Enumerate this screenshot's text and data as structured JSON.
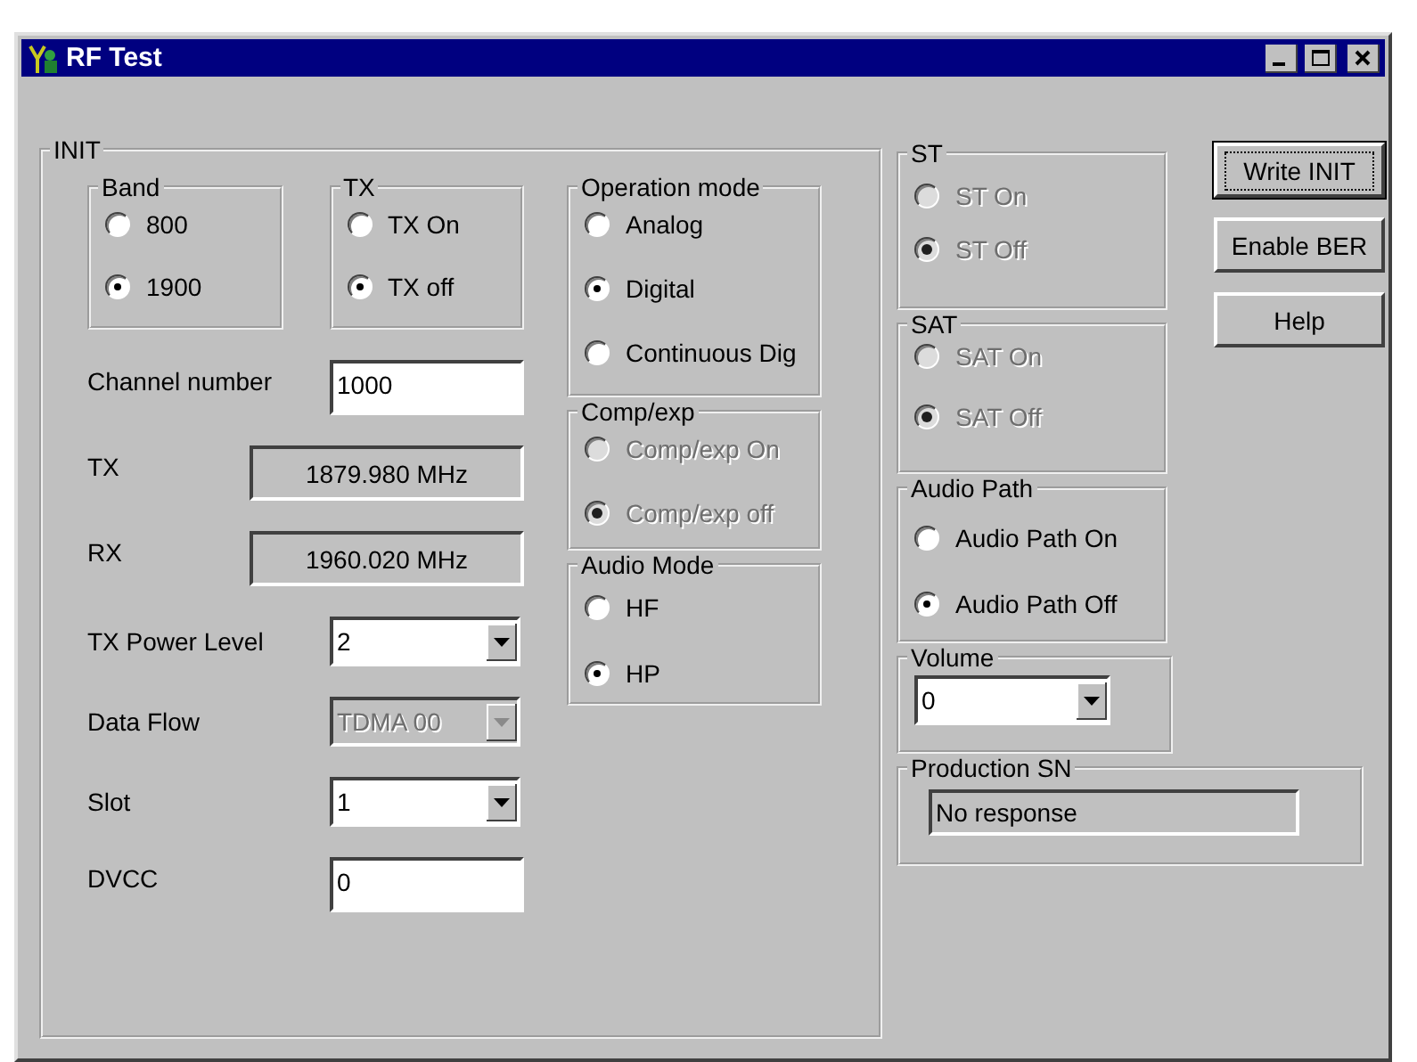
{
  "window": {
    "title": "RF Test"
  },
  "init": {
    "title": "INIT",
    "top_groups": [
      {
        "title": "Band",
        "disabled": false,
        "options": [
          {
            "label": "800",
            "selected": false
          },
          {
            "label": "1900",
            "selected": true
          }
        ]
      },
      {
        "title": "TX",
        "disabled": false,
        "options": [
          {
            "label": "TX On",
            "selected": false
          },
          {
            "label": "TX off",
            "selected": true
          }
        ]
      }
    ],
    "fields": [
      {
        "kind": "input",
        "label": "Channel number",
        "value": "1000",
        "disabled": false
      },
      {
        "kind": "readout",
        "label": "TX",
        "value": "1879.980 MHz",
        "disabled": false
      },
      {
        "kind": "readout",
        "label": "RX",
        "value": "1960.020 MHz",
        "disabled": false
      },
      {
        "kind": "combo",
        "label": "TX Power Level",
        "value": "2",
        "disabled": false
      },
      {
        "kind": "combo",
        "label": "Data Flow",
        "value": "TDMA 00",
        "disabled": true
      },
      {
        "kind": "combo",
        "label": "Slot",
        "value": "1",
        "disabled": false
      },
      {
        "kind": "input",
        "label": "DVCC",
        "value": "0",
        "disabled": false
      }
    ],
    "mode_groups": [
      {
        "title": "Operation mode",
        "disabled": false,
        "options": [
          {
            "label": "Analog",
            "selected": false
          },
          {
            "label": "Digital",
            "selected": true
          },
          {
            "label": "Continuous Dig",
            "selected": false
          }
        ]
      },
      {
        "title": "Comp/exp",
        "disabled": true,
        "options": [
          {
            "label": "Comp/exp On",
            "selected": false
          },
          {
            "label": "Comp/exp off",
            "selected": true
          }
        ]
      },
      {
        "title": "Audio Mode",
        "disabled": false,
        "options": [
          {
            "label": "HF",
            "selected": false
          },
          {
            "label": "HP",
            "selected": true
          }
        ]
      }
    ]
  },
  "side_groups": [
    {
      "title": "ST",
      "disabled": true,
      "options": [
        {
          "label": "ST On",
          "selected": false
        },
        {
          "label": "ST Off",
          "selected": true
        }
      ]
    },
    {
      "title": "SAT",
      "disabled": true,
      "options": [
        {
          "label": "SAT On",
          "selected": false
        },
        {
          "label": "SAT Off",
          "selected": true
        }
      ]
    },
    {
      "title": "Audio Path",
      "disabled": false,
      "options": [
        {
          "label": "Audio Path On",
          "selected": false
        },
        {
          "label": "Audio Path Off",
          "selected": true
        }
      ]
    }
  ],
  "volume": {
    "title": "Volume",
    "value": "0"
  },
  "buttons": [
    {
      "label": "Write INIT",
      "focused": true
    },
    {
      "label": "Enable BER",
      "focused": false
    },
    {
      "label": "Help",
      "focused": false
    }
  ],
  "production_sn": {
    "title": "Production SN",
    "value": "No response"
  }
}
